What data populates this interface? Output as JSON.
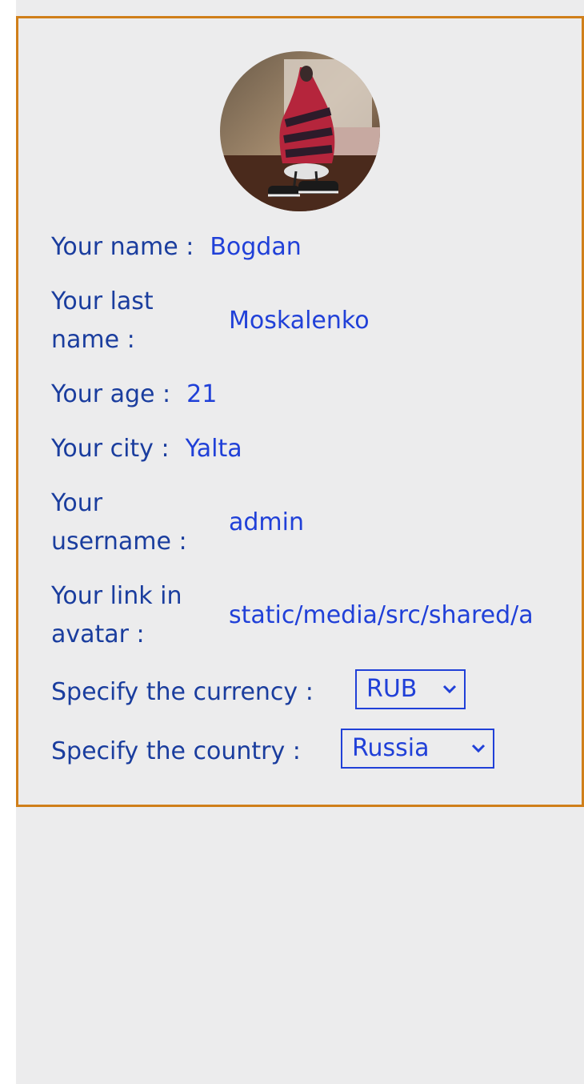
{
  "profile": {
    "avatar_icon": "avatar-photo",
    "fields": {
      "name": {
        "label": "Your name :",
        "value": "Bogdan"
      },
      "last_name": {
        "label_line1": "Your last",
        "label_line2": "name :",
        "value": "Moskalenko"
      },
      "age": {
        "label": "Your age :",
        "value": "21"
      },
      "city": {
        "label": "Your city :",
        "value": "Yalta"
      },
      "username": {
        "label_line1": "Your",
        "label_line2": "username :",
        "value": "admin"
      },
      "avatar_link": {
        "label_line1": "Your link in",
        "label_line2": "avatar :",
        "value": "static/media/src/shared/a"
      }
    },
    "currency": {
      "label": "Specify the currency :",
      "selected": "RUB"
    },
    "country": {
      "label": "Specify the country :",
      "selected": "Russia"
    }
  },
  "colors": {
    "border": "#d07f1a",
    "background": "#ececed",
    "label": "#1a3d9e",
    "value": "#2040d8"
  }
}
